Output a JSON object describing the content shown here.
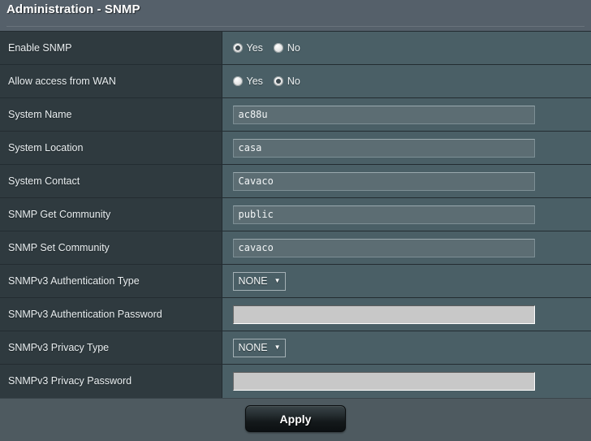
{
  "header": {
    "title": "Administration - SNMP"
  },
  "form": {
    "rows": [
      {
        "label": "Enable SNMP",
        "type": "radio",
        "options": [
          {
            "label": "Yes",
            "checked": true
          },
          {
            "label": "No",
            "checked": false
          }
        ]
      },
      {
        "label": "Allow access from WAN",
        "type": "radio",
        "options": [
          {
            "label": "Yes",
            "checked": false
          },
          {
            "label": "No",
            "checked": true
          }
        ]
      },
      {
        "label": "System Name",
        "type": "text",
        "value": "ac88u",
        "placeholder": "",
        "disabled": false
      },
      {
        "label": "System Location",
        "type": "text",
        "value": "casa",
        "placeholder": "",
        "disabled": false
      },
      {
        "label": "System Contact",
        "type": "text",
        "value": "Cavaco",
        "placeholder": "",
        "disabled": false
      },
      {
        "label": "SNMP Get Community",
        "type": "text",
        "value": "public",
        "placeholder": "",
        "disabled": false
      },
      {
        "label": "SNMP Set Community",
        "type": "text",
        "value": "cavaco",
        "placeholder": "",
        "disabled": false
      },
      {
        "label": "SNMPv3 Authentication Type",
        "type": "select",
        "value": "NONE",
        "caret": "▼"
      },
      {
        "label": "SNMPv3 Authentication Password",
        "type": "text",
        "value": "",
        "placeholder": "",
        "disabled": true
      },
      {
        "label": "SNMPv3 Privacy Type",
        "type": "select",
        "value": "NONE",
        "caret": "▼"
      },
      {
        "label": "SNMPv3 Privacy Password",
        "type": "text",
        "value": "",
        "placeholder": "",
        "disabled": true
      }
    ]
  },
  "footer": {
    "apply_label": "Apply"
  },
  "colors": {
    "header_bg": "#55606a",
    "label_bg": "#2f3a3f",
    "value_bg": "#4a5f66",
    "input_bg": "#5c6d73",
    "disabled_input_bg": "#c8c8c8",
    "footer_bg": "#4e5a60",
    "text": "#e9eef0"
  }
}
